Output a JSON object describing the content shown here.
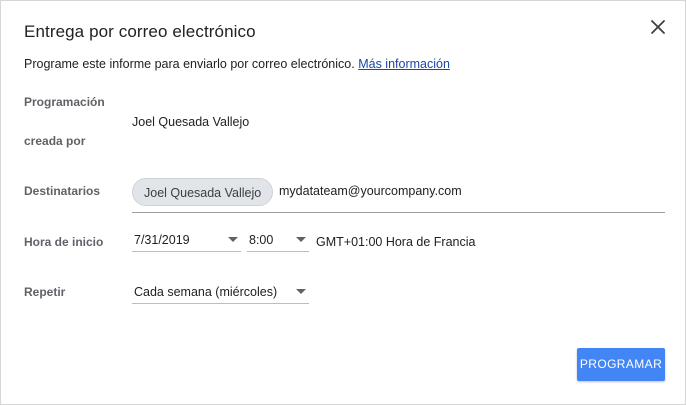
{
  "dialog": {
    "title": "Entrega por correo electrónico",
    "close_icon": "close-icon",
    "description": "Programe este informe para enviarlo por correo electrónico.",
    "more_info_link": "Más información"
  },
  "schedule_creator": {
    "label_line1": "Programación",
    "label_line2": "creada por",
    "value": "Joel Quesada Vallejo"
  },
  "recipients": {
    "label": "Destinatarios",
    "chips": [
      "Joel Quesada Vallejo"
    ],
    "input_value": "mydatateam@yourcompany.com"
  },
  "start_time": {
    "label": "Hora de inicio",
    "date_value": "7/31/2019",
    "time_value": "8:00",
    "timezone": "GMT+01:00 Hora de Francia"
  },
  "repeat": {
    "label": "Repetir",
    "value": "Cada semana (miércoles)"
  },
  "actions": {
    "schedule_button": "PROGRAMAR"
  },
  "colors": {
    "accent": "#4285f4",
    "link": "#1a47a7",
    "chip_bg": "#e1e4e8"
  }
}
